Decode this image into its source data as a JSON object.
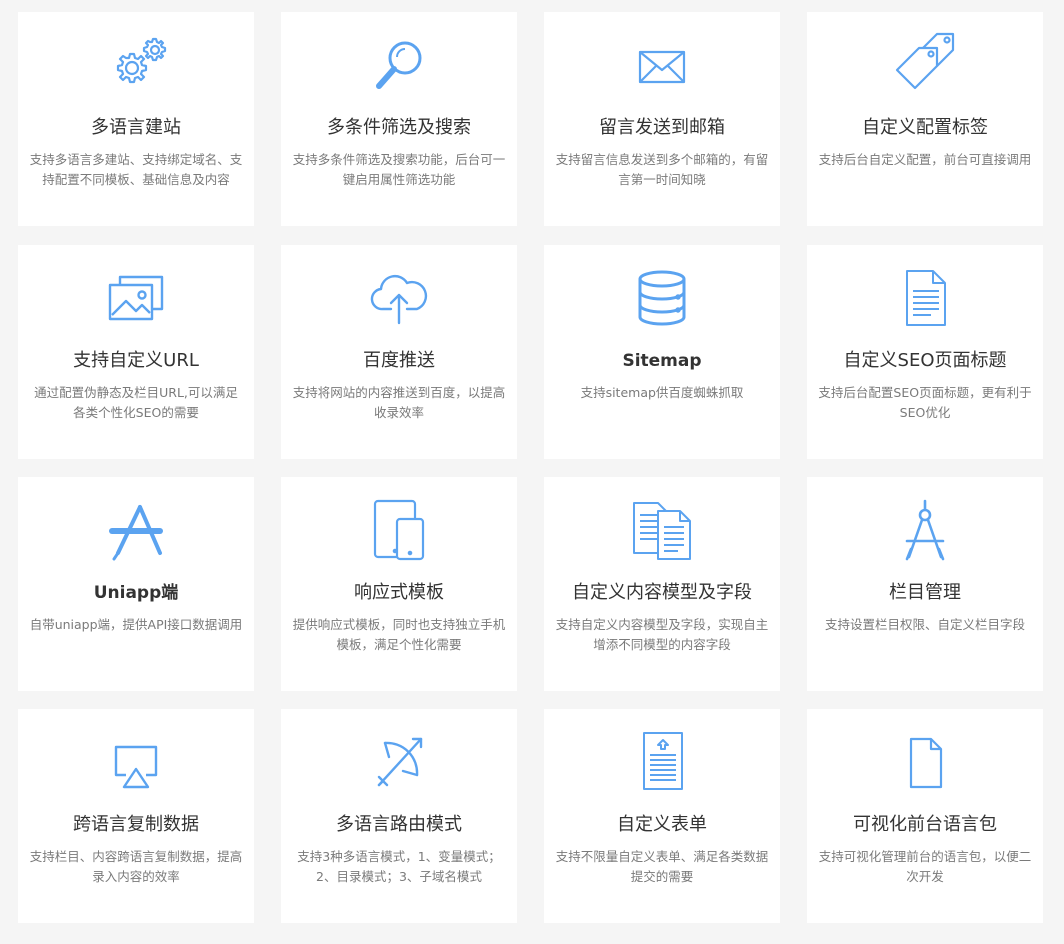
{
  "colors": {
    "icon": "#5ba3f0",
    "title": "#333333",
    "desc": "#7a7a7a",
    "background": "#f5f5f5",
    "card": "#ffffff"
  },
  "features": [
    {
      "icon": "gears-icon",
      "title": "多语言建站",
      "desc": "支持多语言多建站、支持绑定域名、支持配置不同模板、基础信息及内容"
    },
    {
      "icon": "magnifier-icon",
      "title": "多条件筛选及搜索",
      "desc": "支持多条件筛选及搜索功能，后台可一键启用属性筛选功能"
    },
    {
      "icon": "envelope-icon",
      "title": "留言发送到邮箱",
      "desc": "支持留言信息发送到多个邮箱的，有留言第一时间知晓"
    },
    {
      "icon": "tags-icon",
      "title": "自定义配置标签",
      "desc": "支持后台自定义配置，前台可直接调用"
    },
    {
      "icon": "images-icon",
      "title": "支持自定义URL",
      "desc": "通过配置伪静态及栏目URL,可以满足各类个性化SEO的需要"
    },
    {
      "icon": "cloud-upload-icon",
      "title": "百度推送",
      "desc": "支持将网站的内容推送到百度，以提高收录效率"
    },
    {
      "icon": "database-icon",
      "title": "Sitemap",
      "desc": "支持sitemap供百度蜘蛛抓取"
    },
    {
      "icon": "document-icon",
      "title": "自定义SEO页面标题",
      "desc": "支持后台配置SEO页面标题，更有利于SEO优化"
    },
    {
      "icon": "app-store-icon",
      "title": "Uniapp端",
      "desc": "自带uniapp端，提供API接口数据调用"
    },
    {
      "icon": "responsive-devices-icon",
      "title": "响应式模板",
      "desc": "提供响应式模板，同时也支持独立手机模板，满足个性化需要"
    },
    {
      "icon": "documents-icon",
      "title": "自定义内容模型及字段",
      "desc": "支持自定义内容模型及字段，实现自主增添不同模型的内容字段"
    },
    {
      "icon": "compass-icon",
      "title": "栏目管理",
      "desc": "支持设置栏目权限、自定义栏目字段"
    },
    {
      "icon": "airplay-icon",
      "title": "跨语言复制数据",
      "desc": "支持栏目、内容跨语言复制数据，提高录入内容的效率"
    },
    {
      "icon": "bow-arrow-icon",
      "title": "多语言路由模式",
      "desc": "支持3种多语言模式，1、变量模式；2、目录模式；3、子域名模式"
    },
    {
      "icon": "form-document-icon",
      "title": "自定义表单",
      "desc": "支持不限量自定义表单、满足各类数据提交的需要"
    },
    {
      "icon": "file-icon",
      "title": "可视化前台语言包",
      "desc": "支持可视化管理前台的语言包，以便二次开发"
    }
  ]
}
